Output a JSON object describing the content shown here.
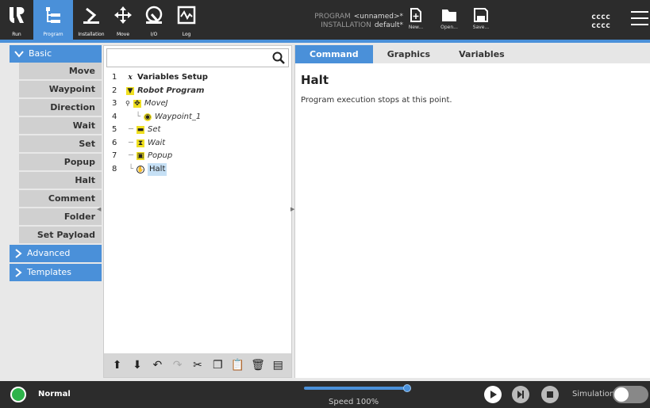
{
  "topbar": {
    "nav": [
      {
        "label": "Run",
        "icon": "ur-logo-icon"
      },
      {
        "label": "Program",
        "icon": "program-icon",
        "active": true
      },
      {
        "label": "Installation",
        "icon": "installation-icon"
      },
      {
        "label": "Move",
        "icon": "move-icon"
      },
      {
        "label": "I/O",
        "icon": "io-icon"
      },
      {
        "label": "Log",
        "icon": "log-icon"
      }
    ],
    "program_label": "PROGRAM",
    "program_value": "<unnamed>*",
    "installation_label": "INSTALLATION",
    "installation_value": "default*",
    "file_buttons": [
      {
        "label": "New...",
        "icon": "new-file-icon"
      },
      {
        "label": "Open...",
        "icon": "folder-icon"
      },
      {
        "label": "Save...",
        "icon": "save-icon"
      }
    ],
    "robot_name_1": "cccc",
    "robot_name_2": "cccc"
  },
  "leftnav": {
    "basic_label": "Basic",
    "basic_items": [
      "Move",
      "Waypoint",
      "Direction",
      "Wait",
      "Set",
      "Popup",
      "Halt",
      "Comment",
      "Folder",
      "Set Payload"
    ],
    "advanced_label": "Advanced",
    "templates_label": "Templates"
  },
  "tree": {
    "rows": [
      {
        "num": "1",
        "label": "Variables Setup",
        "icon": "x-variable-icon"
      },
      {
        "num": "2",
        "label": "Robot Program",
        "icon": "robot-program-icon"
      },
      {
        "num": "3",
        "label": "MoveJ",
        "icon": "movej-icon"
      },
      {
        "num": "4",
        "label": "Waypoint_1",
        "icon": "waypoint-icon"
      },
      {
        "num": "5",
        "label": "Set",
        "icon": "set-icon"
      },
      {
        "num": "6",
        "label": "Wait",
        "icon": "wait-icon"
      },
      {
        "num": "7",
        "label": "Popup",
        "icon": "popup-icon"
      },
      {
        "num": "8",
        "label": "Halt",
        "icon": "halt-icon"
      }
    ],
    "toolbar": [
      "move-up-icon",
      "move-down-icon",
      "undo-icon",
      "redo-icon",
      "cut-icon",
      "copy-icon",
      "paste-icon",
      "delete-icon",
      "suppress-icon"
    ]
  },
  "right": {
    "tabs": [
      "Command",
      "Graphics",
      "Variables"
    ],
    "title": "Halt",
    "description": "Program execution stops at this point."
  },
  "bottombar": {
    "status": "Normal",
    "speed_label": "Speed 100%",
    "speed_value": 1.0,
    "simulation_label": "Simulation",
    "status_color": "#2db34a",
    "accent_color": "#4a90d9"
  }
}
